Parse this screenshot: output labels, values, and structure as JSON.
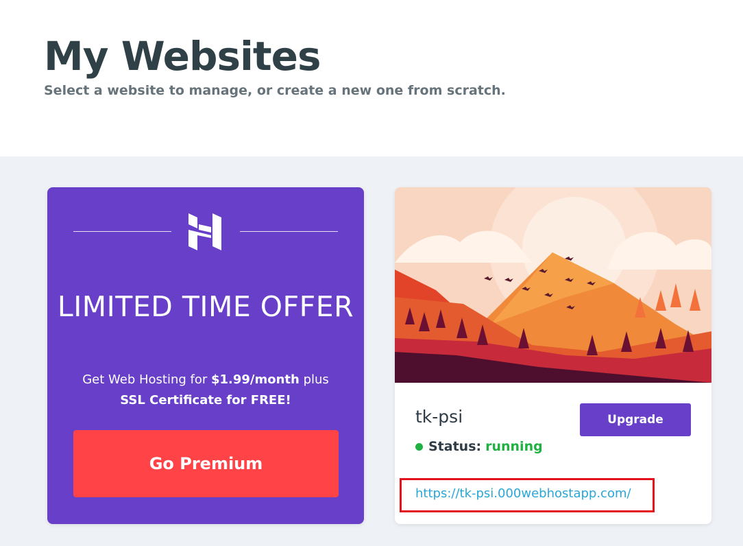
{
  "header": {
    "title": "My Websites",
    "subtitle": "Select a website to manage, or create a new one from scratch."
  },
  "promo": {
    "title": "LIMITED TIME OFFER",
    "desc_prefix": "Get Web Hosting for ",
    "desc_price": "$1.99/month",
    "desc_suffix": " plus",
    "desc_line2": "SSL Certificate for FREE!",
    "button_label": "Go Premium",
    "logo_icon": "hostinger-logo-icon"
  },
  "site": {
    "name": "tk-psi",
    "status_label": "Status:",
    "status_value": "running",
    "upgrade_label": "Upgrade",
    "url": "https://tk-psi.000webhostapp.com/",
    "thumbnail_icon": "mountain-landscape-thumbnail"
  },
  "colors": {
    "brand_purple": "#673fc8",
    "premium_red": "#ff4347",
    "status_green": "#1fb141",
    "link_blue": "#2aa6d8",
    "highlight_red": "#e3121c"
  }
}
